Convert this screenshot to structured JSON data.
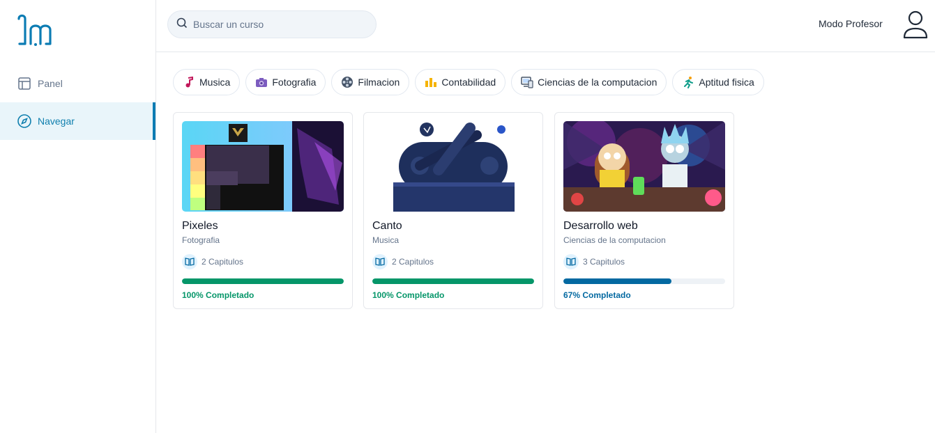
{
  "sidebar": {
    "items": [
      {
        "label": "Panel",
        "icon": "layout-icon",
        "active": false
      },
      {
        "label": "Navegar",
        "icon": "compass-icon",
        "active": true
      }
    ]
  },
  "header": {
    "search_placeholder": "Buscar un curso",
    "teacher_mode_label": "Modo Profesor"
  },
  "categories": [
    {
      "label": "Musica",
      "icon": "music-note-icon"
    },
    {
      "label": "Fotografia",
      "icon": "camera-icon"
    },
    {
      "label": "Filmacion",
      "icon": "film-reel-icon"
    },
    {
      "label": "Contabilidad",
      "icon": "bar-chart-icon"
    },
    {
      "label": "Ciencias de la computacion",
      "icon": "computer-icon"
    },
    {
      "label": "Aptitud fisica",
      "icon": "runner-icon"
    }
  ],
  "courses": [
    {
      "title": "Pixeles",
      "category": "Fotografia",
      "chapters": "2 Capitulos",
      "progress": 100,
      "progress_label": "100% Completado",
      "color": "#059669"
    },
    {
      "title": "Canto",
      "category": "Musica",
      "chapters": "2 Capitulos",
      "progress": 100,
      "progress_label": "100% Completado",
      "color": "#059669"
    },
    {
      "title": "Desarrollo web",
      "category": "Ciencias de la computacion",
      "chapters": "3 Capitulos",
      "progress": 67,
      "progress_label": "67% Completado",
      "color": "#0369a1"
    }
  ],
  "colors": {
    "accent": "#0c7cb3",
    "active_bg": "#e9f5fa",
    "complete": "#059669",
    "in_progress": "#0369a1"
  }
}
